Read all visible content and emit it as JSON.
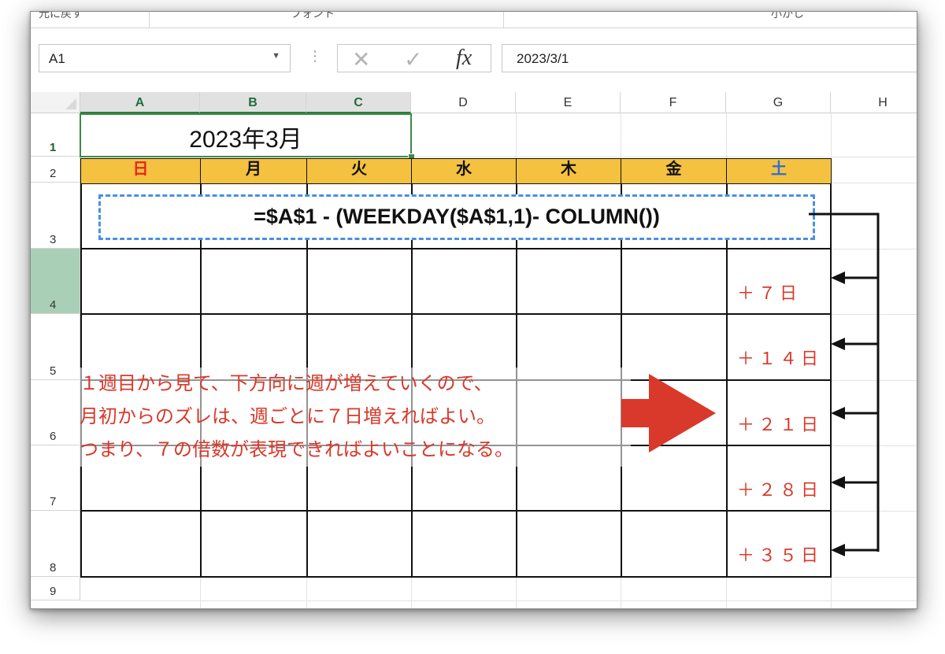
{
  "ribbon": {
    "group_labels": [
      "元に戻す",
      "フォント",
      "小かし"
    ]
  },
  "formula_bar": {
    "name_box": "A1",
    "name_box_arrow": "▼",
    "dots": "⋮",
    "cancel_glyph": "✕",
    "enter_glyph": "✓",
    "fx_label": "fx",
    "value": "2023/3/1"
  },
  "columns": [
    "A",
    "B",
    "C",
    "D",
    "E",
    "F",
    "G",
    "H"
  ],
  "rows": [
    "1",
    "2",
    "3",
    "4",
    "5",
    "6",
    "7",
    "8",
    "9"
  ],
  "sheet": {
    "title": "2023年3月",
    "weekdays": [
      {
        "label": "日",
        "color": "#e8251c"
      },
      {
        "label": "月",
        "color": "#111111"
      },
      {
        "label": "火",
        "color": "#111111"
      },
      {
        "label": "水",
        "color": "#111111"
      },
      {
        "label": "木",
        "color": "#111111"
      },
      {
        "label": "金",
        "color": "#111111"
      },
      {
        "label": "土",
        "color": "#2b6fd6"
      }
    ],
    "header_fill": "#f4c140",
    "formula": "=$A$1 - (WEEKDAY($A$1,1)- COLUMN())",
    "offsets": [
      "＋７日",
      "＋１４日",
      "＋２１日",
      "＋２８日",
      "＋３５日"
    ]
  },
  "annotation": {
    "lines": [
      "１週目から見て、下方向に週が増えていくので、",
      "月初からのズレは、週ごとに７日増えればよい。",
      "つまり、７の倍数が表現できればよいことになる。"
    ],
    "color": "#d8392b"
  }
}
